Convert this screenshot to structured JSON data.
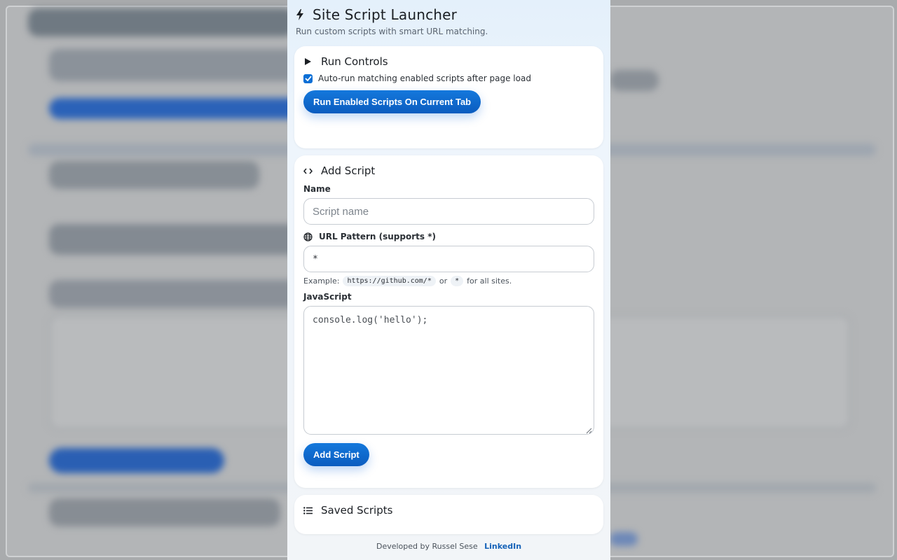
{
  "popup": {
    "title": "Site Script Launcher",
    "subtitle": "Run custom scripts with smart URL matching."
  },
  "run_controls": {
    "title": "Run Controls",
    "autorun_label": "Auto-run matching enabled scripts after page load",
    "autorun_checked": true,
    "run_button": "Run Enabled Scripts On Current Tab"
  },
  "add_script": {
    "title": "Add Script",
    "name_label": "Name",
    "name_placeholder": "Script name",
    "url_label": "URL Pattern (supports *)",
    "url_value": "*",
    "example_prefix": "Example:",
    "example_code1": "https://github.com/*",
    "example_or": "or",
    "example_code2": "*",
    "example_suffix": "for all sites.",
    "js_label": "JavaScript",
    "js_placeholder": "console.log('hello');",
    "add_button": "Add Script"
  },
  "saved_scripts": {
    "title": "Saved Scripts"
  },
  "footer": {
    "text": "Developed by Russel Sese",
    "link": "LinkedIn"
  },
  "colors": {
    "accent": "#0b6fd6",
    "link": "#1562b8"
  }
}
